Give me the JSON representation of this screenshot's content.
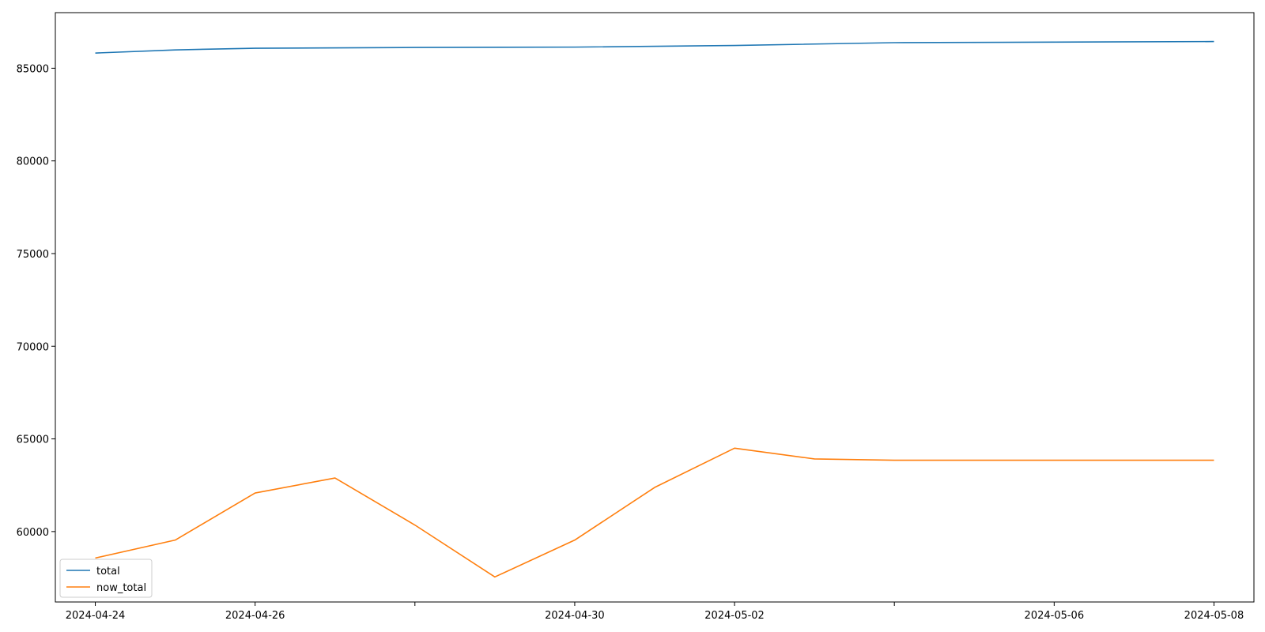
{
  "chart_data": {
    "type": "line",
    "title": "",
    "xlabel": "",
    "ylabel": "",
    "x": [
      "2024-04-24",
      "2024-04-25",
      "2024-04-26",
      "2024-04-27",
      "2024-04-28",
      "2024-04-29",
      "2024-04-30",
      "2024-05-01",
      "2024-05-02",
      "2024-05-03",
      "2024-05-04",
      "2024-05-05",
      "2024-05-06",
      "2024-05-07",
      "2024-05-08"
    ],
    "series": [
      {
        "name": "total",
        "color": "#1f77b4",
        "x": [
          "2024-04-24",
          "2024-04-25",
          "2024-04-26",
          "2024-04-28",
          "2024-04-30",
          "2024-05-02",
          "2024-05-04",
          "2024-05-06",
          "2024-05-08"
        ],
        "values": [
          85820,
          85990,
          86080,
          86120,
          86140,
          86230,
          86380,
          86410,
          86440
        ]
      },
      {
        "name": "now_total",
        "color": "#ff7f0e",
        "x": [
          "2024-04-24",
          "2024-04-25",
          "2024-04-26",
          "2024-04-27",
          "2024-04-28",
          "2024-04-29",
          "2024-04-30",
          "2024-05-01",
          "2024-05-02",
          "2024-05-03",
          "2024-05-04",
          "2024-05-05",
          "2024-05-06",
          "2024-05-07",
          "2024-05-08"
        ],
        "values": [
          58570,
          59540,
          62080,
          62890,
          60350,
          57550,
          59540,
          62380,
          64500,
          63920,
          63850,
          63850,
          63850,
          63850,
          63850
        ]
      }
    ],
    "xticks": [
      "2024-04-24",
      "2024-04-26",
      "2024-04-28",
      "2024-04-30",
      "2024-05-02",
      "2024-05-04",
      "2024-05-06",
      "2024-05-08"
    ],
    "xtick_labels": [
      "2024-04-24",
      "2024-04-26",
      "2024-04-30",
      "2024-05-02",
      "2024-05-06",
      "2024-05-08"
    ],
    "yticks": [
      60000,
      65000,
      70000,
      75000,
      80000,
      85000
    ],
    "ylim": [
      56200,
      88000
    ],
    "xlim": [
      "2024-04-23T12:00",
      "2024-05-08T12:00"
    ],
    "grid": false,
    "legend_position": "lower-left"
  }
}
